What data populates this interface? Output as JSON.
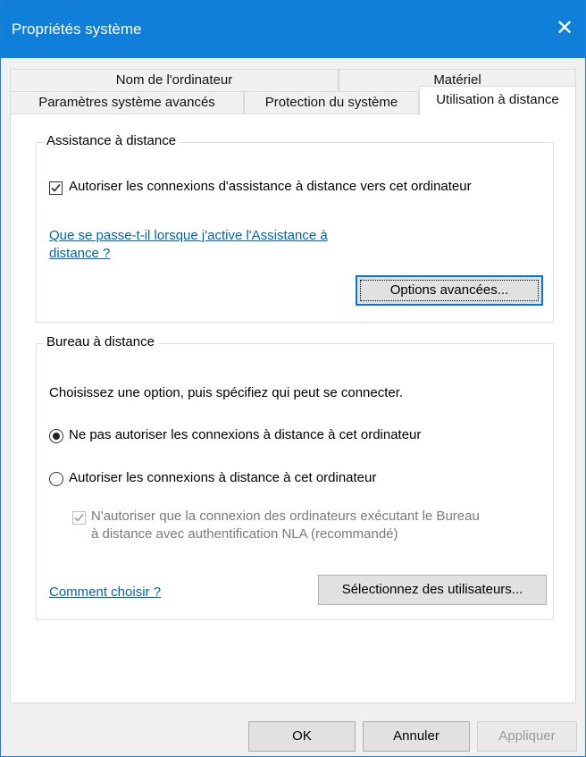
{
  "window": {
    "title": "Propriétés système",
    "close_icon": "close-icon"
  },
  "tabs": {
    "row1": [
      "Nom de l'ordinateur",
      "Matériel"
    ],
    "row2": [
      "Paramètres système avancés",
      "Protection du système",
      "Utilisation à distance"
    ],
    "active": "Utilisation à distance"
  },
  "remote_assistance": {
    "group_title": "Assistance à distance",
    "checkbox_label": "Autoriser les connexions d'assistance à distance vers cet ordinateur",
    "checkbox_checked": true,
    "help_link_line1": "Que se passe-t-il lorsque j'active l'Assistance à",
    "help_link_line2": "distance ?",
    "advanced_button": "Options avancées..."
  },
  "remote_desktop": {
    "group_title": "Bureau à distance",
    "instruction": "Choisissez une option, puis spécifiez qui peut se connecter.",
    "option_deny": "Ne pas autoriser les connexions à distance à cet ordinateur",
    "option_allow": "Autoriser les connexions à distance à cet ordinateur",
    "selected_option": "deny",
    "nla_line1": "N'autoriser que la connexion des ordinateurs exécutant le Bureau",
    "nla_line2": "à distance avec authentification NLA (recommandé)",
    "nla_checked": true,
    "nla_enabled": false,
    "how_to_choose_link": "Comment choisir ?",
    "select_users_button": "Sélectionnez des utilisateurs..."
  },
  "footer": {
    "ok": "OK",
    "cancel": "Annuler",
    "apply": "Appliquer"
  },
  "colors": {
    "titlebar": "#0f7fd9",
    "link": "#0063b1",
    "focus": "#0078d7"
  }
}
